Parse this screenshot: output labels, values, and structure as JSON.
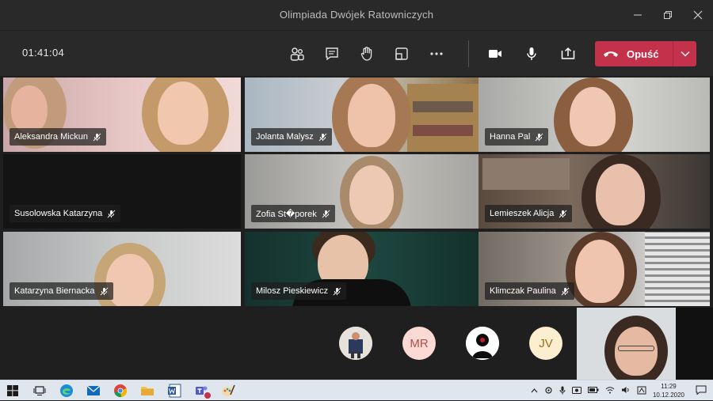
{
  "window": {
    "title": "Olimpiada Dwójek Ratowniczych"
  },
  "toolbar": {
    "timer": "01:41:04",
    "leave_label": "Opuść"
  },
  "participants": [
    {
      "name": "Aleksandra Mickun"
    },
    {
      "name": "Jolanta Malysz"
    },
    {
      "name": "Hanna Pal"
    },
    {
      "name": "Susolowska Katarzyna"
    },
    {
      "name": "Zofia St�porek"
    },
    {
      "name": "Lemieszek Alicja"
    },
    {
      "name": "Katarzyna Biernacka"
    },
    {
      "name": "Milosz Pieskiewicz"
    },
    {
      "name": "Klimczak Paulina"
    }
  ],
  "avatars": [
    {
      "initials": ""
    },
    {
      "initials": "MR"
    },
    {
      "initials": ""
    },
    {
      "initials": "JV"
    }
  ],
  "taskbar": {
    "time": "11:29",
    "date": "10.12.2020"
  },
  "colors": {
    "leave": "#c4314b",
    "bg": "#1f1f1f",
    "bar": "#292929"
  }
}
